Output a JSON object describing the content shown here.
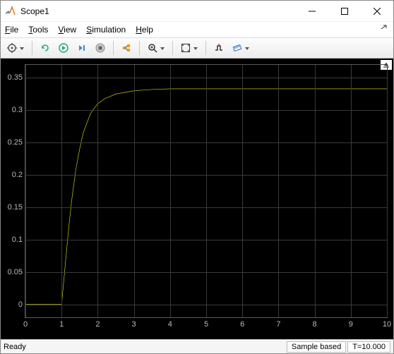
{
  "window": {
    "title": "Scope1"
  },
  "menu": {
    "file": "File",
    "tools": "Tools",
    "view": "View",
    "simulation": "Simulation",
    "help": "Help"
  },
  "status": {
    "ready": "Ready",
    "mode": "Sample based",
    "time": "T=10.000"
  },
  "chart_data": {
    "type": "line",
    "xlabel": "",
    "ylabel": "",
    "xlim": [
      0,
      10
    ],
    "ylim": [
      -0.02,
      0.37
    ],
    "xticks": [
      0,
      1,
      2,
      3,
      4,
      5,
      6,
      7,
      8,
      9,
      10
    ],
    "yticks": [
      0,
      0.05,
      0.1,
      0.15,
      0.2,
      0.25,
      0.3,
      0.35
    ],
    "x": [
      0,
      0.5,
      1.0,
      1.05,
      1.1,
      1.15,
      1.2,
      1.3,
      1.4,
      1.5,
      1.6,
      1.8,
      2.0,
      2.2,
      2.5,
      3.0,
      3.5,
      4.0,
      5.0,
      6.0,
      8.0,
      10.0
    ],
    "y": [
      0,
      0,
      0,
      0.03,
      0.06,
      0.09,
      0.12,
      0.17,
      0.21,
      0.24,
      0.265,
      0.295,
      0.31,
      0.318,
      0.325,
      0.33,
      0.332,
      0.333,
      0.333,
      0.333,
      0.333,
      0.333
    ],
    "line_color": "#e6e619"
  }
}
